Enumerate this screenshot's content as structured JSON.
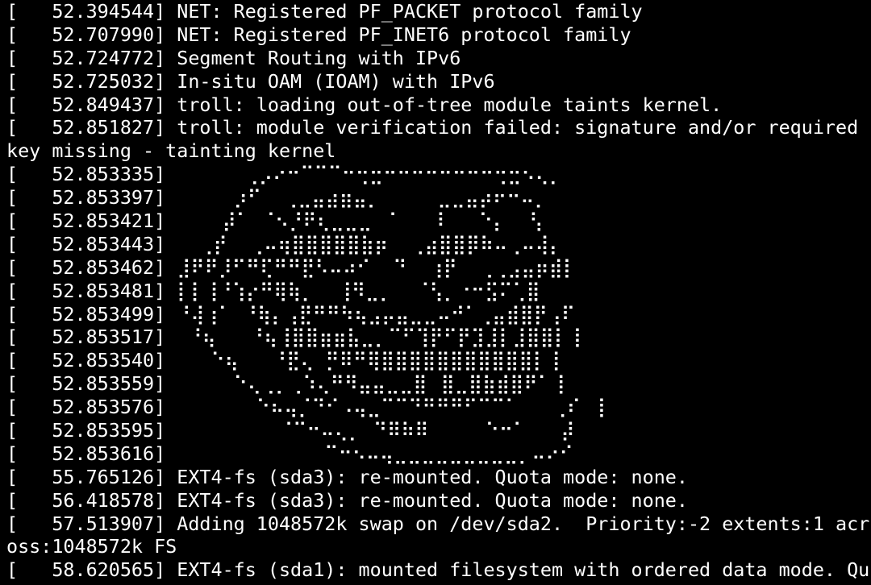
{
  "colors": {
    "background": "#000000",
    "foreground": "#ffffff"
  },
  "console": {
    "lines": [
      "[   52.394544] NET: Registered PF_PACKET protocol family",
      "[   52.707990] NET: Registered PF_INET6 protocol family",
      "[   52.724772] Segment Routing with IPv6",
      "[   52.725032] In-situ OAM (IOAM) with IPv6",
      "[   52.849437] troll: loading out-of-tree module taints kernel.",
      "[   52.851827] troll: module verification failed: signature and/or required",
      "key missing - tainting kernel",
      "[   52.853335]       ⢀⡠⠔⠒⠉⠉⠉⠒⢒⣒⠒⠒⠒⠒⠒⠒⠒⠒⢒⣒⠢⢄⡀",
      "[   52.853397]      ⡰⠋  ⢀⣀⣤⣴⣶⣤⡀     ⣀⣀⣤⡴⠖⠒⠤⡀",
      "[   52.853421]     ⡼⠁ ⠈⠢⡘⠟⢆⣀⣀⣀ ⠈   ⠸   ⠑⡄  ⢣",
      "[   52.853443]   ⢀⡞  ⢀⠤⢶⣿⣿⣿⣿⣿⣷⡶  ⢀⣴⣿⣿⡿⠷⠤⢀⠤⢼⡄",
      "[   52.853462] ⣸⠟⠟⡸⠋⠛⢏⠛⠛⣟⠣⠤⠴⠊  ⠙  ⢰⡟  ⢀⢀⣠⣤⡶⣾⡇",
      "[   52.853481] ⡇⡇⢸⠘⢱⡔⠛⢿⢷⡀  ⢸⠻⣀⡀  ⠈⢣⡀⠐⠒⣫⠍⢁⣿",
      "[   52.853499] ⠘⢼⢰⠁ ⠘⢷⡄⢠⣟⠛⠛⠳⢦⣠⡤⣤⣀⣀⠤⠚⠁⢀⣤⣾⣿⡟⢠⠏",
      "[   52.853517]  ⠘⢦   ⠘⢦⢸⣿⣿⣶⣶⣧⣀⡀⠉⠋⢹⡟⠋⡟⣹⣸⡇⣸⣿⣿⡇⢸",
      "[   52.853540]    ⠑⢦   ⠘⣟⢄ ⡛⠿⠛⢿⣿⣿⣿⣿⣿⣿⣿⣿⣿⣿⣿⡇⢸",
      "[   52.853559]      ⠑⢄⢀⡀⢀⠱⢄⠛⠻⣤⣤⣀⣀⣿⠀⣿⣀⣿⣷⣾⣿⠟⠁⢸",
      "[   52.853576]        ⠑⠦⢤⡈⠙⠊⠠⢤⣀⠉⠉⠙⠛⠛⠛⠋⠉⠉⠁   ⢀⠎ ⢸",
      "[   52.853595]          ⠈⠉⠒⠤⢄⡀ ⠙⠿⠷⠿     ⠑⠒⠁   ⡼",
      "[   52.853616]              ⠉⠒⠢⠤⢤⣀⣀⣀⣀⣀⣀⣀⣀⣀⡀⠤⠔⠊",
      "[   55.765126] EXT4-fs (sda3): re-mounted. Quota mode: none.",
      "[   56.418578] EXT4-fs (sda3): re-mounted. Quota mode: none.",
      "[   57.513907] Adding 1048572k swap on /dev/sda2.  Priority:-2 extents:1 acr",
      "oss:1048572k FS",
      "[   58.620565] EXT4-fs (sda1): mounted filesystem with ordered data mode. Qu"
    ]
  }
}
